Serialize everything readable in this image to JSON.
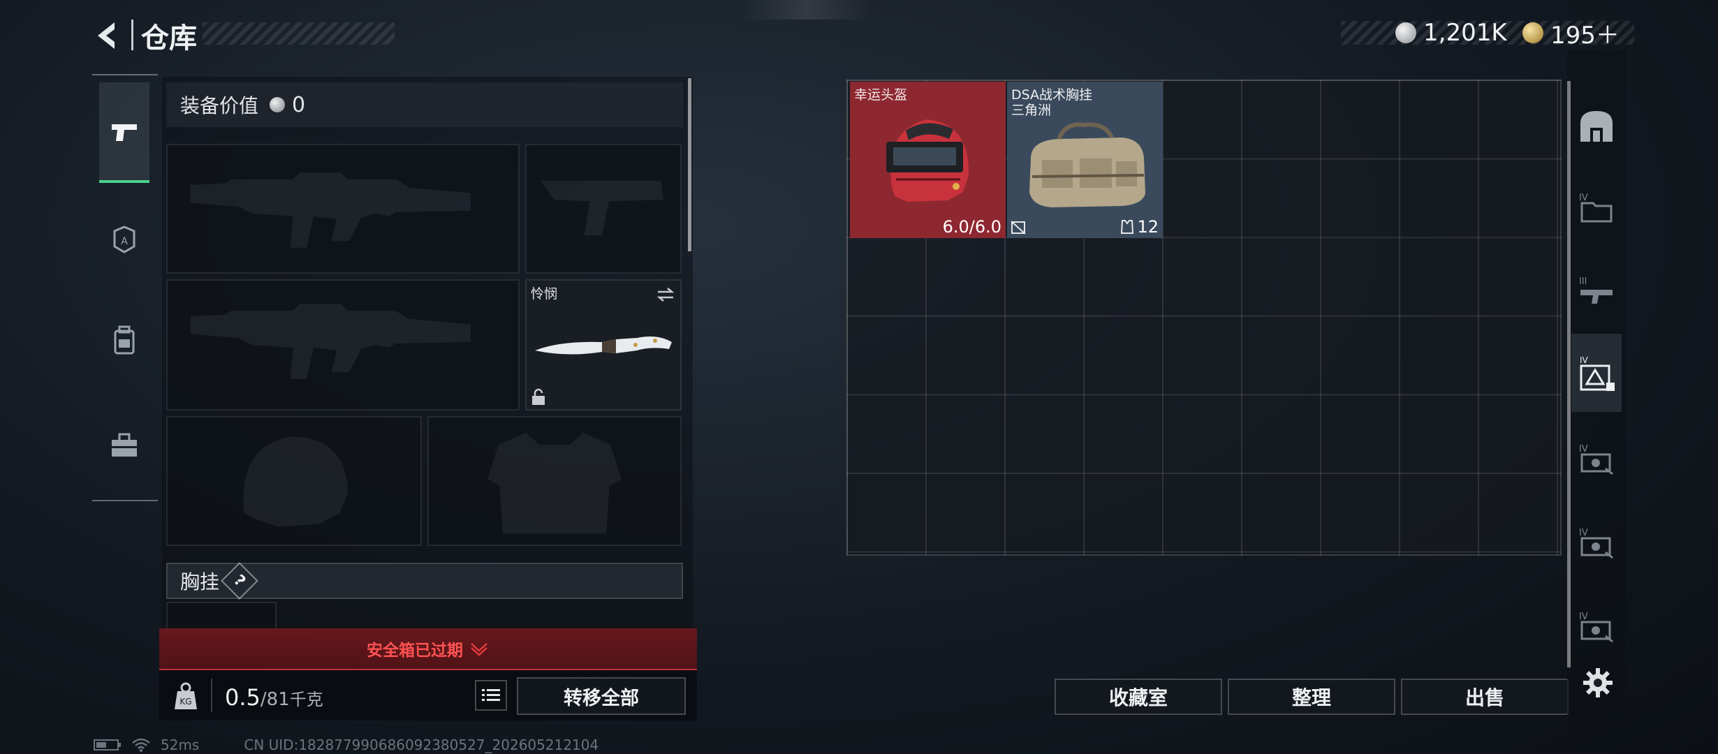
{
  "header": {
    "title": "仓库",
    "currency_silver": "1,201K",
    "currency_gold": "195＋"
  },
  "equipment": {
    "value_label": "装备价值",
    "value": "0",
    "knife_name": "怜悯",
    "rig_label": "胸挂",
    "rig_help": "?"
  },
  "safebox": {
    "expired_text": "安全箱已过期"
  },
  "weight": {
    "current": "0.5",
    "max": "/81",
    "unit": "千克",
    "transfer_all": "转移全部"
  },
  "stash": {
    "items": [
      {
        "name": "幸运头盔",
        "subtitle": "",
        "stat": "6.0/6.0",
        "bg": "#8e2830"
      },
      {
        "name": "DSA战术胸挂",
        "subtitle": "三角洲",
        "stat": "12",
        "bg": "#3a4a5c"
      }
    ],
    "buttons": {
      "collection": "收藏室",
      "organize": "整理",
      "sell": "出售"
    }
  },
  "status_bar": {
    "ping": "52ms",
    "uid": "CN UID:182877990686092380527_202605212104"
  },
  "colors": {
    "accent_green": "#49d18e",
    "alert_red": "#e23a3a",
    "helmet_bg": "#8e2830",
    "rig_bg": "#3a4a5c"
  },
  "icons": {
    "left_tabs": [
      "pistol-icon",
      "armor-tier-icon",
      "backpack-icon",
      "toolbox-icon"
    ],
    "right_tabs": [
      "vault-icon",
      "folder-iv-icon",
      "weapon-iii-icon",
      "gear-iv-icon",
      "loot-iv-icon",
      "loot-iv-icon",
      "loot-iv-icon"
    ]
  }
}
